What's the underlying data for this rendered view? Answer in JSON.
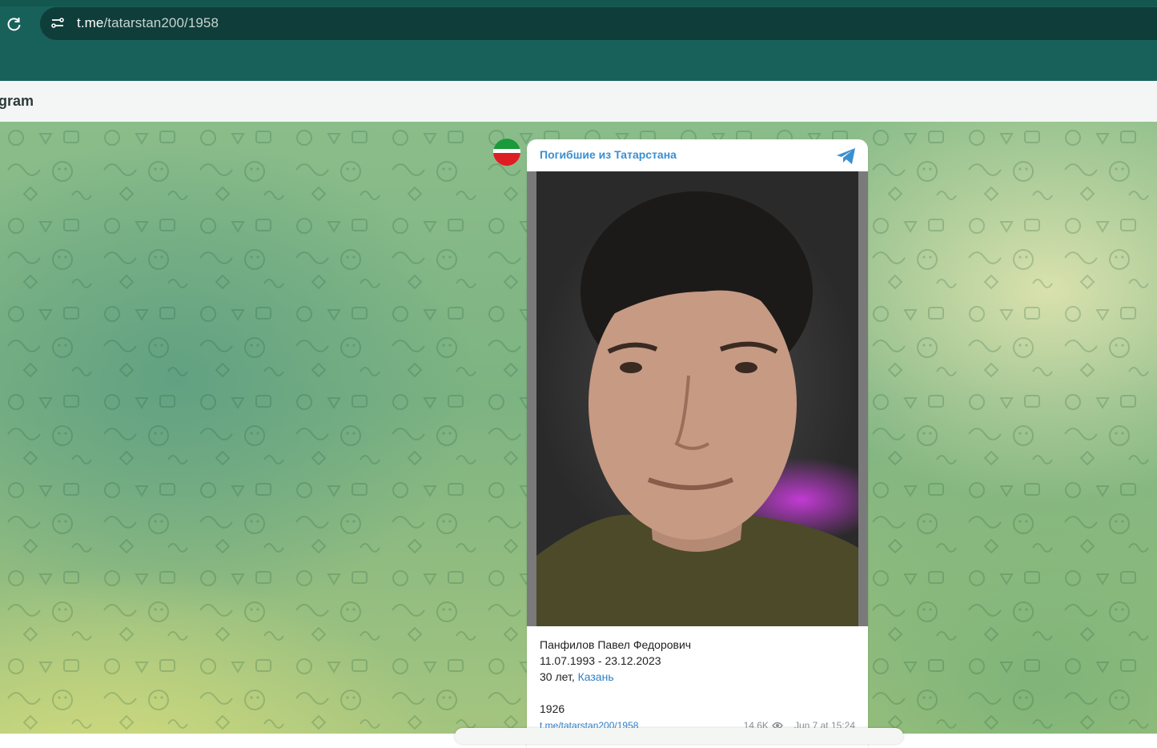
{
  "browser": {
    "url_host": "t.me",
    "url_path": "/tatarstan200/1958"
  },
  "header": {
    "title": "gram"
  },
  "post": {
    "channel_name": "Погибшие из Татарстана",
    "lines": {
      "name": "Панфилов Павел Федорович",
      "dates": "11.07.1993 - 23.12.2023",
      "age": "30 лет,",
      "city": "Казань",
      "number": "1926"
    },
    "link": "t.me/tatarstan200/1958",
    "views": "14.6K",
    "date": "Jun 7 at 15:24"
  },
  "colors": {
    "chrome": "#17615a",
    "omnibox": "#0f3d39",
    "link": "#2f7fc4",
    "channel": "#3a8fd1"
  },
  "icons": [
    "reload-icon",
    "site-info-icon",
    "telegram-icon",
    "eye-icon"
  ]
}
